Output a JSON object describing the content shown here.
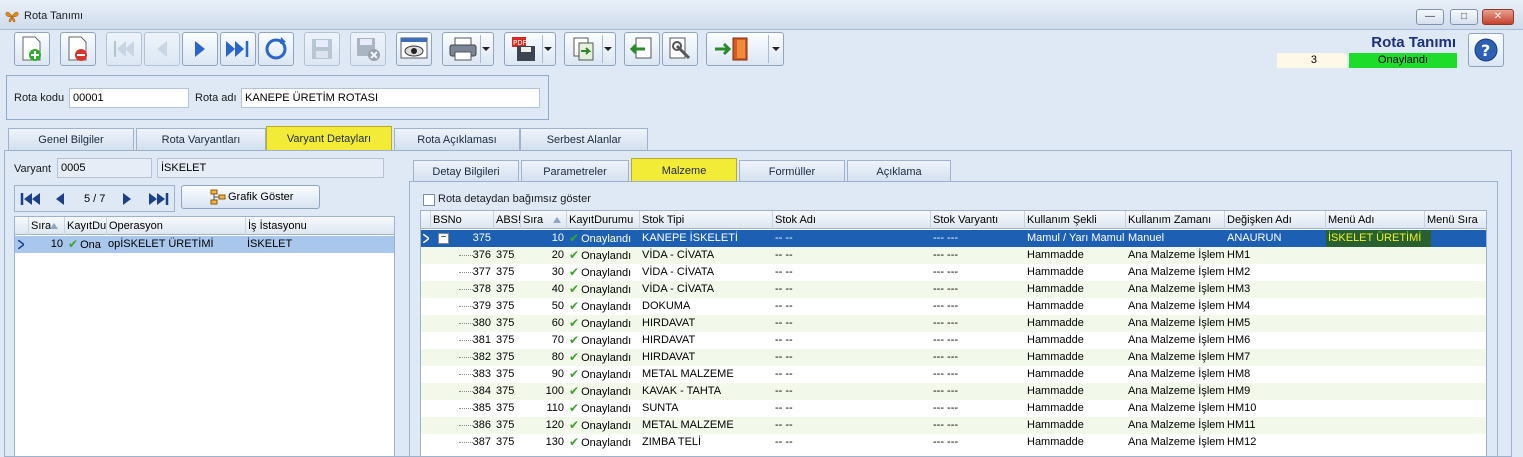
{
  "window": {
    "title": "Rota Tanımı"
  },
  "toolbar": {
    "buttons": [
      "new-record",
      "delete-record",
      "first-record",
      "previous-record",
      "next-record",
      "last-record",
      "refresh",
      "save",
      "save-and-close",
      "preview",
      "print",
      "pdf-export",
      "export",
      "import",
      "tools",
      "exit"
    ]
  },
  "header": {
    "heading": "Rota Tanımı",
    "count": "3",
    "status": "Onaylandı",
    "status_color": "#1edc2a",
    "rota_kodu_label": "Rota kodu",
    "rota_kodu_value": "00001",
    "rota_adi_label": "Rota adı",
    "rota_adi_value": "KANEPE ÜRETİM ROTASI"
  },
  "main_tabs": [
    {
      "label": "Genel Bilgiler"
    },
    {
      "label": "Rota Varyantları"
    },
    {
      "label": "Varyant Detayları",
      "active": true
    },
    {
      "label": "Rota Açıklaması"
    },
    {
      "label": "Serbest Alanlar"
    }
  ],
  "variant": {
    "label": "Varyant",
    "code": "0005",
    "name": "İSKELET",
    "nav_position": "5 / 7",
    "graph_button": "Grafik Göster"
  },
  "left_grid": {
    "columns": [
      "Sıra",
      "KayıtDu",
      "Operasyon",
      "İş İstasyonu"
    ],
    "rows": [
      {
        "sira": "10",
        "kayit": "Ona",
        "operasyon": "opİSKELET ÜRETİMİ",
        "istasyon": "İSKELET"
      }
    ]
  },
  "detail_tabs": [
    {
      "label": "Detay Bilgileri"
    },
    {
      "label": "Parametreler"
    },
    {
      "label": "Malzeme",
      "active": true
    },
    {
      "label": "Formüller"
    },
    {
      "label": "Açıklama"
    }
  ],
  "independent_checkbox_label": "Rota detaydan bağımsız göster",
  "material_grid": {
    "columns": [
      "BSNo",
      "ABS!",
      "Sıra",
      "KayıtDurumu",
      "Stok Tipi",
      "Stok Adı",
      "Stok Varyantı",
      "Kullanım Şekli",
      "Kullanım Zamanı",
      "Değişken Adı",
      "Menü Adı",
      "Menü Sıra"
    ],
    "rows": [
      {
        "bsno": "375",
        "abs": "",
        "sira": "10",
        "durum": "Onaylandı",
        "stok_tipi": "KANEPE İSKELETİ",
        "stok_adi": "-- --",
        "varyant": "--- ---",
        "kullanim": "Mamul / Yarı Mamul",
        "zaman": "Manuel",
        "degisken": "ANAURUN",
        "menu": "İSKELET ÜRETİMİ",
        "menu_sira": ""
      },
      {
        "bsno": "376",
        "abs": "375",
        "sira": "20",
        "durum": "Onaylandı",
        "stok_tipi": "VİDA - CİVATA",
        "stok_adi": "-- --",
        "varyant": "--- ---",
        "kullanim": "Hammadde",
        "zaman": "Ana Malzeme İşlemi",
        "degisken": "HM1",
        "menu": "",
        "menu_sira": ""
      },
      {
        "bsno": "377",
        "abs": "375",
        "sira": "30",
        "durum": "Onaylandı",
        "stok_tipi": "VİDA - CİVATA",
        "stok_adi": "-- --",
        "varyant": "--- ---",
        "kullanim": "Hammadde",
        "zaman": "Ana Malzeme İşlemi",
        "degisken": "HM2",
        "menu": "",
        "menu_sira": ""
      },
      {
        "bsno": "378",
        "abs": "375",
        "sira": "40",
        "durum": "Onaylandı",
        "stok_tipi": "VİDA - CİVATA",
        "stok_adi": "-- --",
        "varyant": "--- ---",
        "kullanim": "Hammadde",
        "zaman": "Ana Malzeme İşlemi",
        "degisken": "HM3",
        "menu": "",
        "menu_sira": ""
      },
      {
        "bsno": "379",
        "abs": "375",
        "sira": "50",
        "durum": "Onaylandı",
        "stok_tipi": "DOKUMA",
        "stok_adi": "-- --",
        "varyant": "--- ---",
        "kullanim": "Hammadde",
        "zaman": "Ana Malzeme İşlemi",
        "degisken": "HM4",
        "menu": "",
        "menu_sira": ""
      },
      {
        "bsno": "380",
        "abs": "375",
        "sira": "60",
        "durum": "Onaylandı",
        "stok_tipi": "HIRDAVAT",
        "stok_adi": "-- --",
        "varyant": "--- ---",
        "kullanim": "Hammadde",
        "zaman": "Ana Malzeme İşlemi",
        "degisken": "HM5",
        "menu": "",
        "menu_sira": ""
      },
      {
        "bsno": "381",
        "abs": "375",
        "sira": "70",
        "durum": "Onaylandı",
        "stok_tipi": "HIRDAVAT",
        "stok_adi": "-- --",
        "varyant": "--- ---",
        "kullanim": "Hammadde",
        "zaman": "Ana Malzeme İşlemi",
        "degisken": "HM6",
        "menu": "",
        "menu_sira": ""
      },
      {
        "bsno": "382",
        "abs": "375",
        "sira": "80",
        "durum": "Onaylandı",
        "stok_tipi": "HIRDAVAT",
        "stok_adi": "-- --",
        "varyant": "--- ---",
        "kullanim": "Hammadde",
        "zaman": "Ana Malzeme İşlemi",
        "degisken": "HM7",
        "menu": "",
        "menu_sira": ""
      },
      {
        "bsno": "383",
        "abs": "375",
        "sira": "90",
        "durum": "Onaylandı",
        "stok_tipi": "METAL MALZEME",
        "stok_adi": "-- --",
        "varyant": "--- ---",
        "kullanim": "Hammadde",
        "zaman": "Ana Malzeme İşlemi",
        "degisken": "HM8",
        "menu": "",
        "menu_sira": ""
      },
      {
        "bsno": "384",
        "abs": "375",
        "sira": "100",
        "durum": "Onaylandı",
        "stok_tipi": "KAVAK - TAHTA",
        "stok_adi": "-- --",
        "varyant": "--- ---",
        "kullanim": "Hammadde",
        "zaman": "Ana Malzeme İşlemi",
        "degisken": "HM9",
        "menu": "",
        "menu_sira": ""
      },
      {
        "bsno": "385",
        "abs": "375",
        "sira": "110",
        "durum": "Onaylandı",
        "stok_tipi": "SUNTA",
        "stok_adi": "-- --",
        "varyant": "--- ---",
        "kullanim": "Hammadde",
        "zaman": "Ana Malzeme İşlemi",
        "degisken": "HM10",
        "menu": "",
        "menu_sira": ""
      },
      {
        "bsno": "386",
        "abs": "375",
        "sira": "120",
        "durum": "Onaylandı",
        "stok_tipi": "METAL MALZEME",
        "stok_adi": "-- --",
        "varyant": "--- ---",
        "kullanim": "Hammadde",
        "zaman": "Ana Malzeme İşlemi",
        "degisken": "HM11",
        "menu": "",
        "menu_sira": ""
      },
      {
        "bsno": "387",
        "abs": "375",
        "sira": "130",
        "durum": "Onaylandı",
        "stok_tipi": "ZIMBA TELİ",
        "stok_adi": "-- --",
        "varyant": "--- ---",
        "kullanim": "Hammadde",
        "zaman": "Ana Malzeme İşlemi",
        "degisken": "HM12",
        "menu": "",
        "menu_sira": ""
      }
    ]
  }
}
